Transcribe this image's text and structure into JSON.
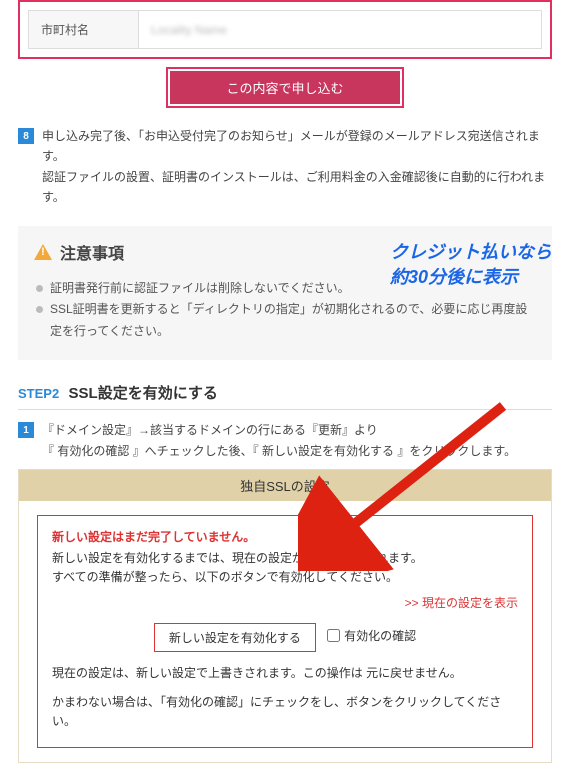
{
  "form": {
    "row_label": "市町村名",
    "row_value": "Locality Name"
  },
  "submit_label": "この内容で申し込む",
  "note8": {
    "num": "8",
    "line1": "申し込み完了後、「お申込受付完了のお知らせ」メールが登録のメールアドレス宛送信されます。",
    "line2": "認証ファイルの設置、証明書のインストールは、ご利用料金の入金確認後に自動的に行われます。"
  },
  "caution": {
    "title": "注意事項",
    "items": [
      "証明書発行前に認証ファイルは削除しないでください。",
      "SSL証明書を更新すると「ディレクトリの指定」が初期化されるので、必要に応じ再度設定を行ってください。"
    ]
  },
  "handnote": {
    "line1": "クレジット払いなら",
    "line2": "約30分後に表示"
  },
  "step2": {
    "label": "STEP2",
    "title": "SSL設定を有効にする",
    "instr_num": "1",
    "instr_line1": "『ドメイン設定』→該当するドメインの行にある『更新』より",
    "instr_line2": "『 有効化の確認 』へチェックした後、『 新しい設定を有効化する 』をクリックします。"
  },
  "panel": {
    "title": "独自SSLの設定",
    "warn": "新しい設定はまだ完了していません。",
    "desc1": "新しい設定を有効化するまでは、現在の設定が続けて使用されます。",
    "desc2": "すべての準備が整ったら、以下のボタンで有効化してください。",
    "link": ">> 現在の設定を表示",
    "button": "新しい設定を有効化する",
    "checkbox": "有効化の確認",
    "note1": "現在の設定は、新しい設定で上書きされます。この操作は 元に戻せません。",
    "note2": "かまわない場合は、「有効化の確認」にチェックをし、ボタンをクリックしてください。"
  }
}
